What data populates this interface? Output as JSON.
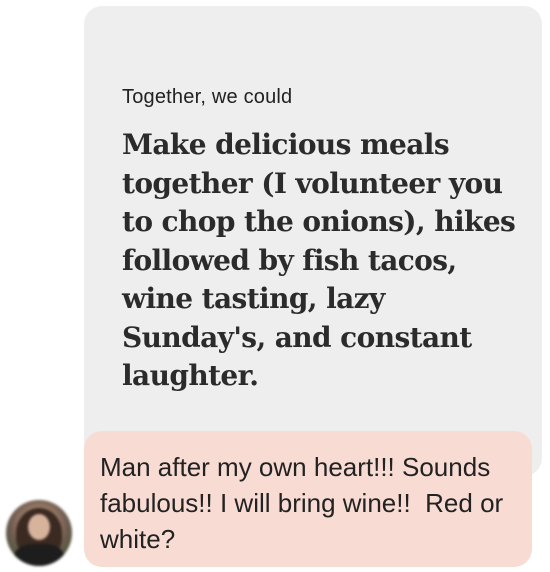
{
  "prompt": {
    "label": "Together, we could",
    "answer": "Make delicious meals together (I volunteer you to chop the onions), hikes followed by fish tacos, wine tasting, lazy Sunday's, and constant laughter."
  },
  "reply": {
    "text": "Man after my own heart!!! Sounds fabulous!! I will bring wine!!  Red or white?"
  },
  "colors": {
    "prompt_card_bg": "#eeeeee",
    "reply_bubble_bg": "#f8dcd4",
    "text": "#222222"
  }
}
